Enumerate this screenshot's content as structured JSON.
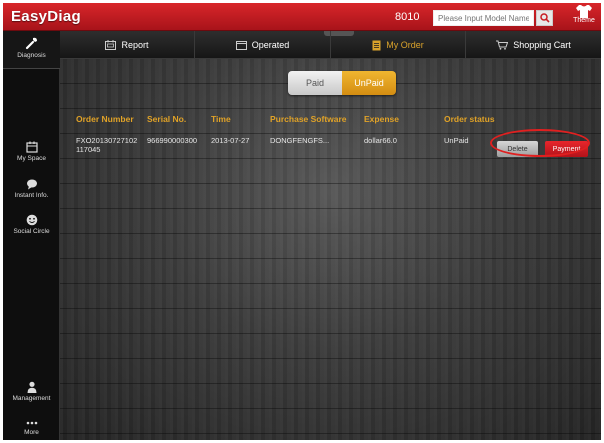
{
  "app": {
    "title": "EasyDiag",
    "code": "8010"
  },
  "search": {
    "placeholder": "Please Input Model Name"
  },
  "theme": {
    "label": "Theme"
  },
  "sidebar": {
    "diagnosis": "Diagnosis",
    "items": [
      {
        "label": "My Space",
        "icon": "calendar-icon"
      },
      {
        "label": "Instant Info.",
        "icon": "chat-icon"
      },
      {
        "label": "Social Circle",
        "icon": "smiley-icon"
      },
      {
        "label": "Management",
        "icon": "person-icon"
      },
      {
        "label": "More",
        "icon": "more-icon"
      }
    ]
  },
  "tabs": [
    {
      "label": "Report",
      "icon": "report-icon"
    },
    {
      "label": "Operated",
      "icon": "window-icon"
    },
    {
      "label": "My Order",
      "icon": "order-icon",
      "active": true
    },
    {
      "label": "Shopping Cart",
      "icon": "cart-icon"
    }
  ],
  "filter": {
    "paid": "Paid",
    "unpaid": "UnPaid",
    "selected": "UnPaid"
  },
  "table": {
    "headers": [
      "Order Number",
      "Serial No.",
      "Time",
      "Purchase Software",
      "Expense",
      "Order status"
    ],
    "rows": [
      {
        "order_number": "FXO20130727102 117045",
        "serial": "966990000300",
        "time": "2013-07-27",
        "software": "DONGFENGFS...",
        "expense": "dollar66.0",
        "status": "UnPaid",
        "delete": "Delete",
        "payment": "Payment"
      }
    ]
  },
  "colors": {
    "brand_red": "#c81d23",
    "accent_gold": "#e0a227",
    "highlight_circle": "#e02020"
  }
}
